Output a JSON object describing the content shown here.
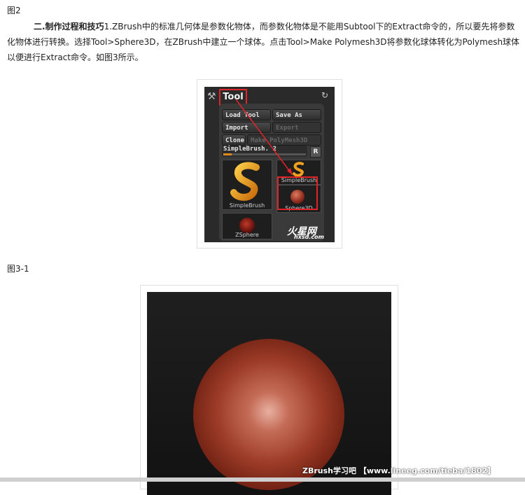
{
  "captions": {
    "fig2_label": "图2",
    "fig31_label": "图3-1"
  },
  "article": {
    "heading": "二.制作过程和技巧",
    "body": "1.ZBrush中的标准几何体是参数化物体，而参数化物体是不能用Subtool下的Extract命令的，所以要先将参数化物体进行转换。选择Tool>Sphere3D，在ZBrush中建立一个球体。点击Tool>Make Polymesh3D将参数化球体转化为Polymesh球体以便进行Extract命令。如图3所示。"
  },
  "tool_panel": {
    "title": "Tool",
    "buttons": {
      "load_tool": "Load Tool",
      "save_as": "Save As",
      "import": "Import",
      "export": "Export",
      "clone": "Clone",
      "make_polymesh": "Make PolyMesh3D"
    },
    "slider_label": "SimpleBrush. 2",
    "r_button": "R",
    "thumbs": {
      "simplebrush_large": "SimpleBrush",
      "simplebrush_small": "SimpleBrush",
      "sphere3d": "Sphere3D",
      "zsphere": "ZSphere"
    },
    "watermark_logo": "火星网",
    "watermark_url": "hxsd.com",
    "highlight_color": "#e0242a"
  },
  "render_watermark": "ZBrush学习吧 【www.lineeg.com/tieba/1802】",
  "icons": [
    "hammer-icon",
    "reset-icon",
    "brush-s-icon",
    "sphere-icon",
    "zsphere-icon",
    "arrow-annotation"
  ]
}
